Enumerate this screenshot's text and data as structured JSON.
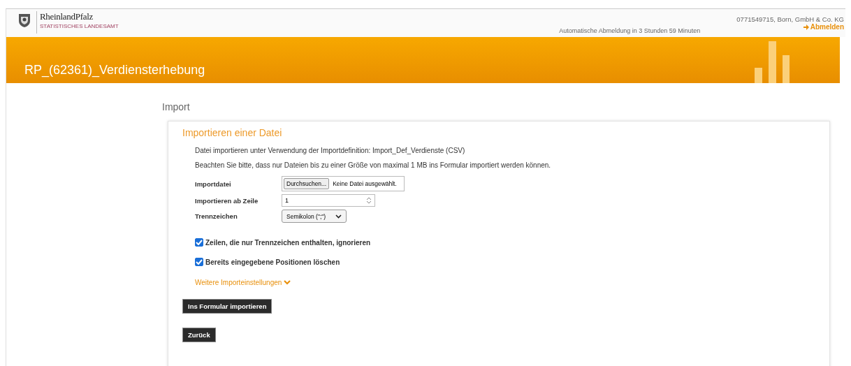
{
  "header": {
    "logo_name": "RheinlandPfalz",
    "logo_subtitle": "STATISTISCHES LANDESAMT",
    "session_notice": "Automatische Abmeldung in 3 Stunden 59 Minuten",
    "user": "0771549715, Born, GmbH & Co. KG",
    "logout": "Abmelden"
  },
  "banner": {
    "title": "RP_(62361)_Verdiensterhebung"
  },
  "page_title": "Import",
  "panel": {
    "title": "Importieren einer Datei",
    "info": [
      "Datei importieren unter Verwendung der Importdefinition: Import_Def_Verdienste (CSV)",
      "Beachten Sie bitte, dass nur Dateien bis zu einer Größe von maximal 1 MB ins Formular importiert werden können."
    ],
    "fields": [
      {
        "kind": "file",
        "label": "Importdatei",
        "button": "Durchsuchen...",
        "value": "Keine Datei ausgewählt."
      },
      {
        "kind": "number",
        "label": "Importieren ab Zeile",
        "value": "1"
      },
      {
        "kind": "select",
        "label": "Trennzeichen",
        "value": "Semikolon (\";\")"
      }
    ],
    "checkboxes": [
      {
        "label": "Zeilen, die nur Trennzeichen enthalten, ignorieren",
        "checked": true
      },
      {
        "label": "Bereits eingegebene Positionen löschen",
        "checked": true
      }
    ],
    "more_settings": {
      "label": "Weitere Importeinstellungen",
      "expanded": false
    },
    "buttons": [
      "Ins Formular importieren",
      "Zurück"
    ]
  }
}
